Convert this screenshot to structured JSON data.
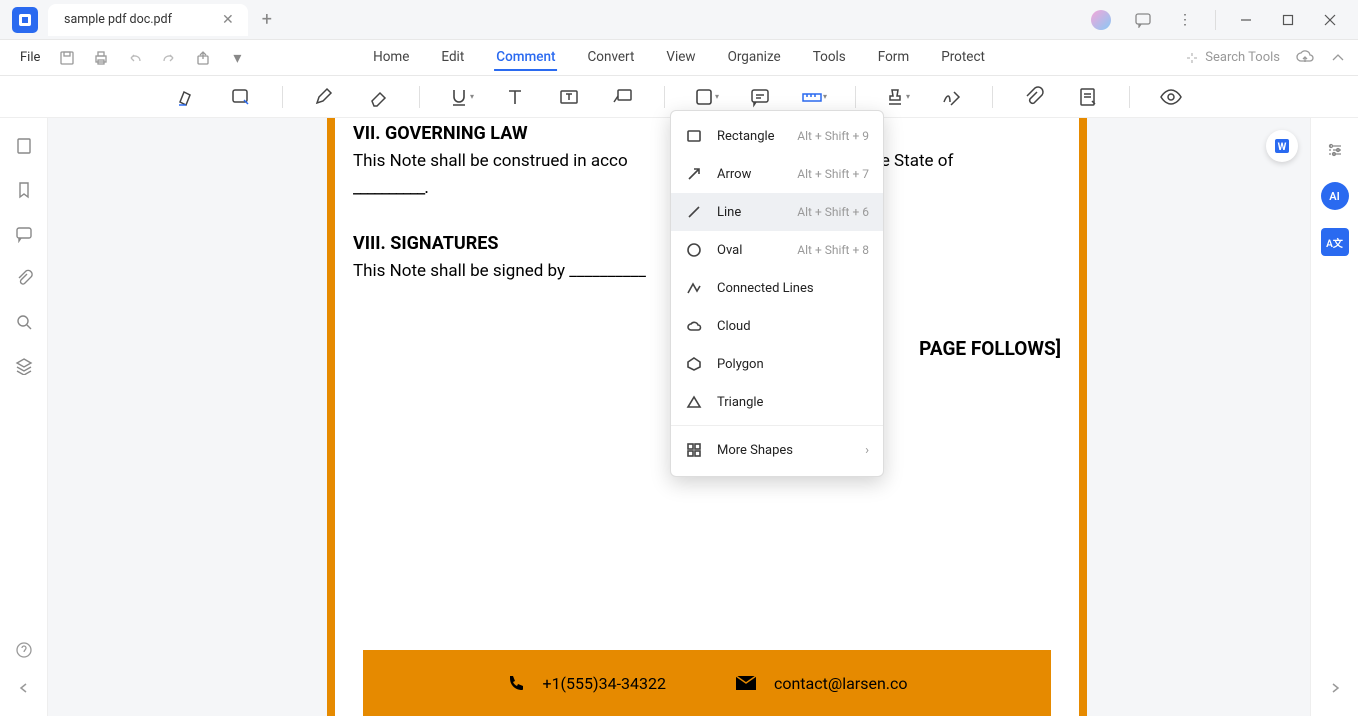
{
  "tab": {
    "title": "sample pdf doc.pdf"
  },
  "file_label": "File",
  "menu": {
    "home": "Home",
    "edit": "Edit",
    "comment": "Comment",
    "convert": "Convert",
    "view": "View",
    "organize": "Organize",
    "tools": "Tools",
    "form": "Form",
    "protect": "Protect"
  },
  "search_placeholder": "Search Tools",
  "doc": {
    "sec7_title": "VII. GOVERNING LAW",
    "sec7_body_a": "This  Note  shall  be  construed  in  acco",
    "sec7_body_b": "of  the  State  of",
    "sec7_blank": "__________.",
    "sec8_title": "VIII. SIGNATURES",
    "sec8_body": "This Note shall be signed by __________",
    "follows": "PAGE FOLLOWS]",
    "phone": "+1(555)34-34322",
    "email": "contact@larsen.co"
  },
  "shapes": {
    "rectangle": {
      "label": "Rectangle",
      "short": "Alt + Shift + 9"
    },
    "arrow": {
      "label": "Arrow",
      "short": "Alt + Shift + 7"
    },
    "line": {
      "label": "Line",
      "short": "Alt + Shift + 6"
    },
    "oval": {
      "label": "Oval",
      "short": "Alt + Shift + 8"
    },
    "connected": {
      "label": "Connected Lines"
    },
    "cloud": {
      "label": "Cloud"
    },
    "polygon": {
      "label": "Polygon"
    },
    "triangle": {
      "label": "Triangle"
    },
    "more": {
      "label": "More Shapes"
    }
  }
}
